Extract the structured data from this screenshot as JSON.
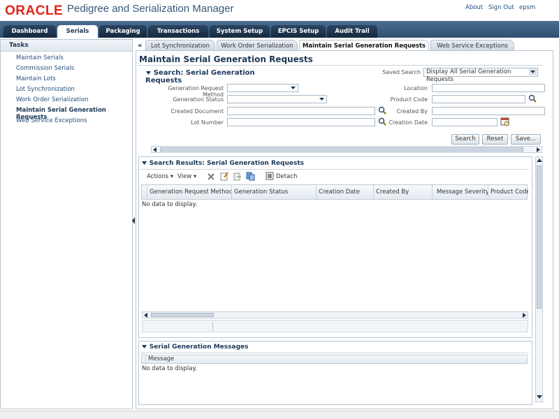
{
  "header": {
    "brand": "ORACLE",
    "app_title": "Pedigree and Serialization Manager",
    "links": [
      "About",
      "Sign Out",
      "epsm"
    ]
  },
  "main_tabs": [
    "Dashboard",
    "Serials",
    "Packaging",
    "Transactions",
    "System Setup",
    "EPCIS Setup",
    "Audit Trail"
  ],
  "active_main_tab": "Serials",
  "tasks": {
    "title": "Tasks",
    "items": [
      "Maintain Serials",
      "Commission Serials",
      "Maintain Lots",
      "Lot Synchronization",
      "Work Order Serialization",
      "Maintain Serial Generation Requests",
      "Web Service Exceptions"
    ],
    "active": "Maintain Serial Generation Requests"
  },
  "sub_tabs": [
    "Lot Synchronization",
    "Work Order Serialization",
    "Maintain Serial Generation Requests",
    "Web Service Exceptions"
  ],
  "active_sub_tab": "Maintain Serial Generation Requests",
  "page_title": "Maintain Serial Generation Requests",
  "search": {
    "title": "Search: Serial Generation Requests",
    "saved_search_label": "Saved Search",
    "saved_search_value": "Display All Serial Generation Requests",
    "fields": {
      "generation_request_method": "Generation Request Method",
      "generation_status": "Generation Status",
      "created_document": "Created Document",
      "lot_number": "Lot Number",
      "location": "Location",
      "product_code": "Product Code",
      "created_by": "Created By",
      "creation_date": "Creation Date"
    },
    "buttons": {
      "search": "Search",
      "reset": "Reset",
      "save": "Save..."
    }
  },
  "results": {
    "title": "Search Results: Serial Generation Requests",
    "actions_label": "Actions",
    "view_label": "View",
    "detach_label": "Detach",
    "columns": [
      "Generation Request Method",
      "Generation Status",
      "Creation Date",
      "Created By",
      "Message Severity",
      "Product Code"
    ],
    "empty_text": "No data to display."
  },
  "messages": {
    "title": "Serial Generation Messages",
    "columns": [
      "Message"
    ],
    "empty_text": "No data to display."
  },
  "colors": {
    "brand_red": "#e2231a",
    "tab_bar": "#2f5073",
    "heading_blue": "#1b3857",
    "link_blue": "#25507a"
  }
}
